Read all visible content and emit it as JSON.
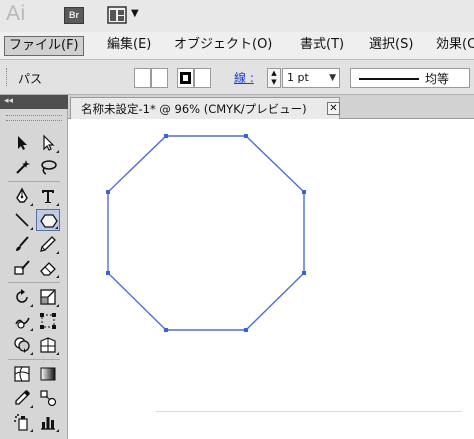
{
  "app": {
    "logo": "Ai",
    "bridge_label": "Br"
  },
  "menu": {
    "items": [
      {
        "label": "ファイル(F)",
        "active": true
      },
      {
        "label": "編集(E)",
        "active": false
      },
      {
        "label": "オブジェクト(O)",
        "active": false
      },
      {
        "label": "書式(T)",
        "active": false
      },
      {
        "label": "選択(S)",
        "active": false
      },
      {
        "label": "効果(C)",
        "active": false
      }
    ]
  },
  "control": {
    "selection_type": "パス",
    "stroke_label": "線 :",
    "stroke_weight": "1 pt",
    "profile_label": "均等"
  },
  "document": {
    "tab_title": "名称未設定-1* @ 96% (CMYK/プレビュー)",
    "close_glyph": "✕"
  },
  "toolpanel": {
    "collapse_glyph": "◂◂"
  },
  "shape": {
    "kind": "octagon",
    "selected": true,
    "stroke_color": "#4f6fd1",
    "anchor_color": "#3a62d9"
  },
  "colors": {
    "stroke_label": "#1a3fd6"
  }
}
